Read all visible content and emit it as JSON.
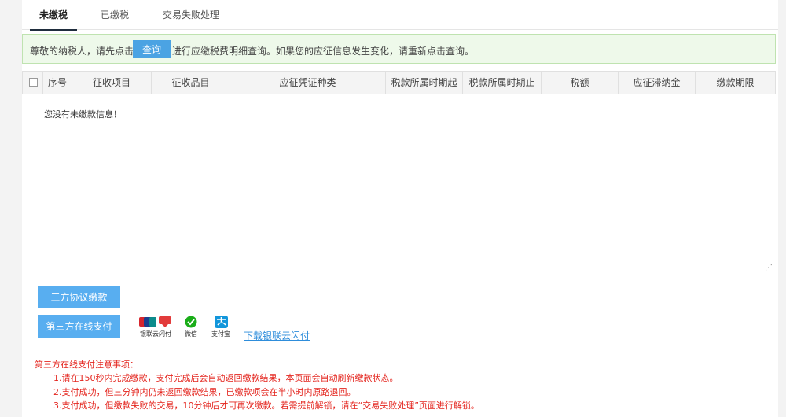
{
  "tabs": [
    {
      "label": "未缴税",
      "active": true
    },
    {
      "label": "已缴税",
      "active": false
    },
    {
      "label": "交易失败处理",
      "active": false
    }
  ],
  "notice": {
    "prefix": "尊敬的纳税人，请先点击",
    "query_button": "查询",
    "suffix": "进行应缴税费明细查询。如果您的应征信息发生变化，请重新点击查询。"
  },
  "table": {
    "columns": [
      "序号",
      "征收项目",
      "征收品目",
      "应征凭证种类",
      "税款所属时期起",
      "税款所属时期止",
      "税额",
      "应征滞纳金",
      "缴款期限"
    ],
    "empty_message": "您没有未缴款信息！"
  },
  "actions": {
    "tripartite_button": "三方协议缴款",
    "online_pay_button": "第三方在线支付",
    "pay_methods": [
      {
        "label": "银联云闪付",
        "icon": "unionpay-icon"
      },
      {
        "label": "微信",
        "icon": "wechat-icon"
      },
      {
        "label": "支付宝",
        "icon": "alipay-icon"
      }
    ],
    "download_link": "下载银联云闪付"
  },
  "notes": {
    "title": "第三方在线支付注意事项：",
    "items": [
      "1.请在150秒内完成缴款，支付完成后会自动返回缴款结果，本页面会自动刷新缴款状态。",
      "2.支付成功，但三分钟内仍未返回缴款结果，已缴款项会在半小时内原路退回。",
      "3.支付成功，但缴款失败的交易，10分钟后才可再次缴款。若需提前解锁，请在“交易失败处理”页面进行解锁。"
    ]
  },
  "colors": {
    "accent": "#4ba3e3",
    "notice_bg": "#eef9ea",
    "warning_text": "#e4261f",
    "link": "#2e8ddb"
  }
}
